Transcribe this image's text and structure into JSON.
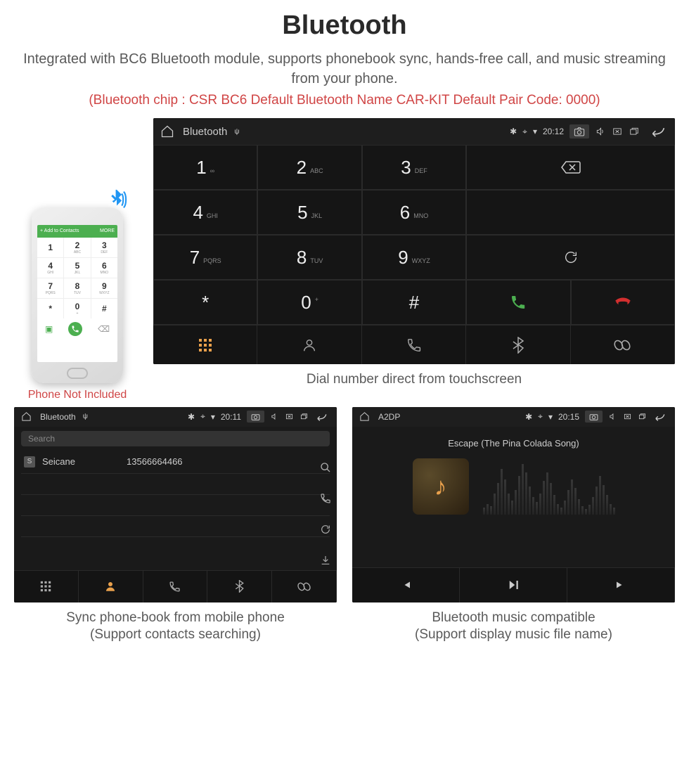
{
  "title": "Bluetooth",
  "subtitle": "Integrated with BC6 Bluetooth module, supports phonebook sync, hands-free call, and music streaming from your phone.",
  "red_note": "(Bluetooth chip : CSR BC6    Default Bluetooth Name CAR-KIT    Default Pair Code: 0000)",
  "phone": {
    "header_label": "Add to Contacts",
    "header_more": "MORE",
    "keys": [
      {
        "d": "1",
        "l": ""
      },
      {
        "d": "2",
        "l": "ABC"
      },
      {
        "d": "3",
        "l": "DEF"
      },
      {
        "d": "4",
        "l": "GHI"
      },
      {
        "d": "5",
        "l": "JKL"
      },
      {
        "d": "6",
        "l": "MNO"
      },
      {
        "d": "7",
        "l": "PQRS"
      },
      {
        "d": "8",
        "l": "TUV"
      },
      {
        "d": "9",
        "l": "WXYZ"
      },
      {
        "d": "*",
        "l": ""
      },
      {
        "d": "0",
        "l": "+"
      },
      {
        "d": "#",
        "l": ""
      }
    ],
    "note": "Phone Not Included"
  },
  "dialer": {
    "status_title": "Bluetooth",
    "status_time": "20:12",
    "keys": [
      {
        "n": "1",
        "l": "∞"
      },
      {
        "n": "2",
        "l": "ABC"
      },
      {
        "n": "3",
        "l": "DEF"
      },
      {
        "n": "4",
        "l": "GHI"
      },
      {
        "n": "5",
        "l": "JKL"
      },
      {
        "n": "6",
        "l": "MNO"
      },
      {
        "n": "7",
        "l": "PQRS"
      },
      {
        "n": "8",
        "l": "TUV"
      },
      {
        "n": "9",
        "l": "WXYZ"
      },
      {
        "n": "*",
        "l": ""
      },
      {
        "n": "0",
        "l": "+"
      },
      {
        "n": "#",
        "l": ""
      }
    ],
    "caption": "Dial number direct from touchscreen"
  },
  "contacts": {
    "status_title": "Bluetooth",
    "status_time": "20:11",
    "search_placeholder": "Search",
    "contact_badge": "S",
    "contact_name": "Seicane",
    "contact_number": "13566664466",
    "caption_line1": "Sync phone-book from mobile phone",
    "caption_line2": "(Support contacts searching)"
  },
  "music": {
    "status_title": "A2DP",
    "status_time": "20:15",
    "song_title": "Escape (The Pina Colada Song)",
    "caption_line1": "Bluetooth music compatible",
    "caption_line2": "(Support display music file name)"
  }
}
